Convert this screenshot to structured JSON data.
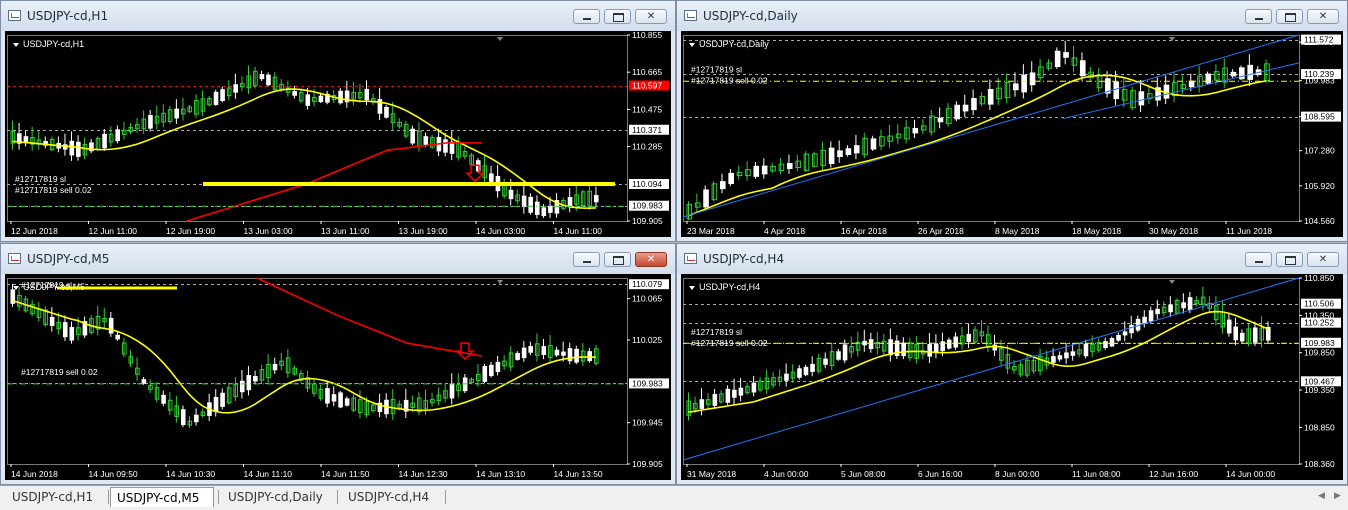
{
  "colors": {
    "bull": "#32cd32",
    "bear": "#ffffff",
    "ma_yellow": "#ffff00",
    "ma_red": "#ff0000",
    "trend_blue": "#1e78ff",
    "grid": "#7a7a7a",
    "axis_text": "#ffffff",
    "red_tag": "#ff0000"
  },
  "icons": {
    "app": "chart-window-icon",
    "minimize": "minimize-icon",
    "maximize": "maximize-icon",
    "close": "close-icon",
    "arrow_down": "red-arrow-down-icon"
  },
  "windows": [
    {
      "title": "USDJPY-cd,H1",
      "label": "USDJPY-cd,H1",
      "ymin": 109.905,
      "ymax": 110.855,
      "yticks": [
        "110.855",
        "110.665",
        "110.475",
        "110.285",
        "109.905"
      ],
      "price_tags": [
        {
          "text": "110.597",
          "value": 110.597,
          "style": "red"
        },
        {
          "text": "110.371",
          "value": 110.371,
          "style": "white"
        },
        {
          "text": "110.094",
          "value": 110.094,
          "style": "white"
        },
        {
          "text": "109.983",
          "value": 109.983,
          "style": "white"
        }
      ],
      "order_labels": [
        "#12717819 sl",
        "#12717819 sell 0.02"
      ],
      "xticks": [
        "12 Jun 2018",
        "12 Jun 11:00",
        "12 Jun 19:00",
        "13 Jun 03:00",
        "13 Jun 11:00",
        "13 Jun 19:00",
        "14 Jun 03:00",
        "14 Jun 11:00"
      ]
    },
    {
      "title": "USDJPY-cd,Daily",
      "label": "USDJPY-cd,Daily",
      "ymin": 104.56,
      "ymax": 111.75,
      "yticks": [
        "111.470",
        "109.983",
        "108.595",
        "107.280",
        "105.920",
        "104.560"
      ],
      "price_tags": [
        {
          "text": "111.572",
          "value": 111.572,
          "style": "white"
        },
        {
          "text": "110.239",
          "value": 110.239,
          "style": "white"
        },
        {
          "text": "108.595",
          "value": 108.595,
          "style": "white"
        }
      ],
      "order_labels": [
        "#12717819 sl",
        "#12717819 sell 0.02"
      ],
      "xticks": [
        "23 Mar 2018",
        "4 Apr 2018",
        "16 Apr 2018",
        "26 Apr 2018",
        "8 May 2018",
        "18 May 2018",
        "30 May 2018",
        "11 Jun 2018"
      ]
    },
    {
      "title": "USDJPY-cd,M5",
      "label": "USDJPY-cd,M5",
      "ymin": 109.905,
      "ymax": 110.085,
      "yticks": [
        "110.065",
        "110.025",
        "109.945",
        "109.905"
      ],
      "price_tags": [
        {
          "text": "110.079",
          "value": 110.079,
          "style": "white"
        },
        {
          "text": "109.983",
          "value": 109.983,
          "style": "white"
        }
      ],
      "order_labels": [
        "#12717819 sl",
        "#12717819 sell 0.02"
      ],
      "xticks": [
        "14 Jun 2018",
        "14 Jun 09:50",
        "14 Jun 10:30",
        "14 Jun 11:10",
        "14 Jun 11:50",
        "14 Jun 12:30",
        "14 Jun 13:10",
        "14 Jun 13:50"
      ]
    },
    {
      "title": "USDJPY-cd,H4",
      "label": "USDJPY-cd,H4",
      "ymin": 108.36,
      "ymax": 110.85,
      "yticks": [
        "110.850",
        "110.350",
        "109.850",
        "109.350",
        "108.850",
        "108.360"
      ],
      "price_tags": [
        {
          "text": "110.506",
          "value": 110.506,
          "style": "white"
        },
        {
          "text": "110.252",
          "value": 110.252,
          "style": "white"
        },
        {
          "text": "109.983",
          "value": 109.983,
          "style": "white"
        },
        {
          "text": "109.467",
          "value": 109.467,
          "style": "white"
        }
      ],
      "order_labels": [
        "#12717819 sl",
        "#12717819 sell 0.02"
      ],
      "xticks": [
        "31 May 2018",
        "4 Jun 00:00",
        "5 Jun 08:00",
        "6 Jun 16:00",
        "8 Jun 00:00",
        "11 Jun 08:00",
        "12 Jun 16:00",
        "14 Jun 00:00"
      ]
    }
  ],
  "tabs": [
    "USDJPY-cd,H1",
    "USDJPY-cd,M5",
    "USDJPY-cd,Daily",
    "USDJPY-cd,H4"
  ],
  "active_tab": "USDJPY-cd,M5"
}
